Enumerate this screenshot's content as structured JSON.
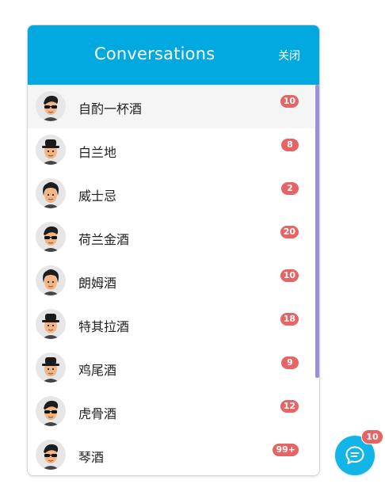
{
  "header": {
    "title": "Conversations",
    "close_label": "关闭"
  },
  "conversations": [
    {
      "name": "自酌一杯酒",
      "unread": "10",
      "avatar": "sunglasses-avatar-icon"
    },
    {
      "name": "白兰地",
      "unread": "8",
      "avatar": "hat-avatar-icon"
    },
    {
      "name": "威士忌",
      "unread": "2",
      "avatar": "curly-hair-avatar-icon"
    },
    {
      "name": "荷兰金酒",
      "unread": "20",
      "avatar": "sunglasses-avatar-icon"
    },
    {
      "name": "朗姆酒",
      "unread": "10",
      "avatar": "curly-hair-avatar-icon"
    },
    {
      "name": "特其拉酒",
      "unread": "18",
      "avatar": "hat-avatar-icon"
    },
    {
      "name": "鸡尾酒",
      "unread": "9",
      "avatar": "hat-avatar-icon"
    },
    {
      "name": "虎骨酒",
      "unread": "12",
      "avatar": "sunglasses-avatar-icon"
    },
    {
      "name": "琴酒",
      "unread": "99+",
      "avatar": "sunglasses-avatar-icon"
    }
  ],
  "chat_button": {
    "badge": "10",
    "icon": "chat-bubble-icon"
  },
  "colors": {
    "header": "#02a9e0",
    "badge": "#e86363",
    "scrollbar": "#9b8fd8",
    "fab": "#12b5e6"
  }
}
